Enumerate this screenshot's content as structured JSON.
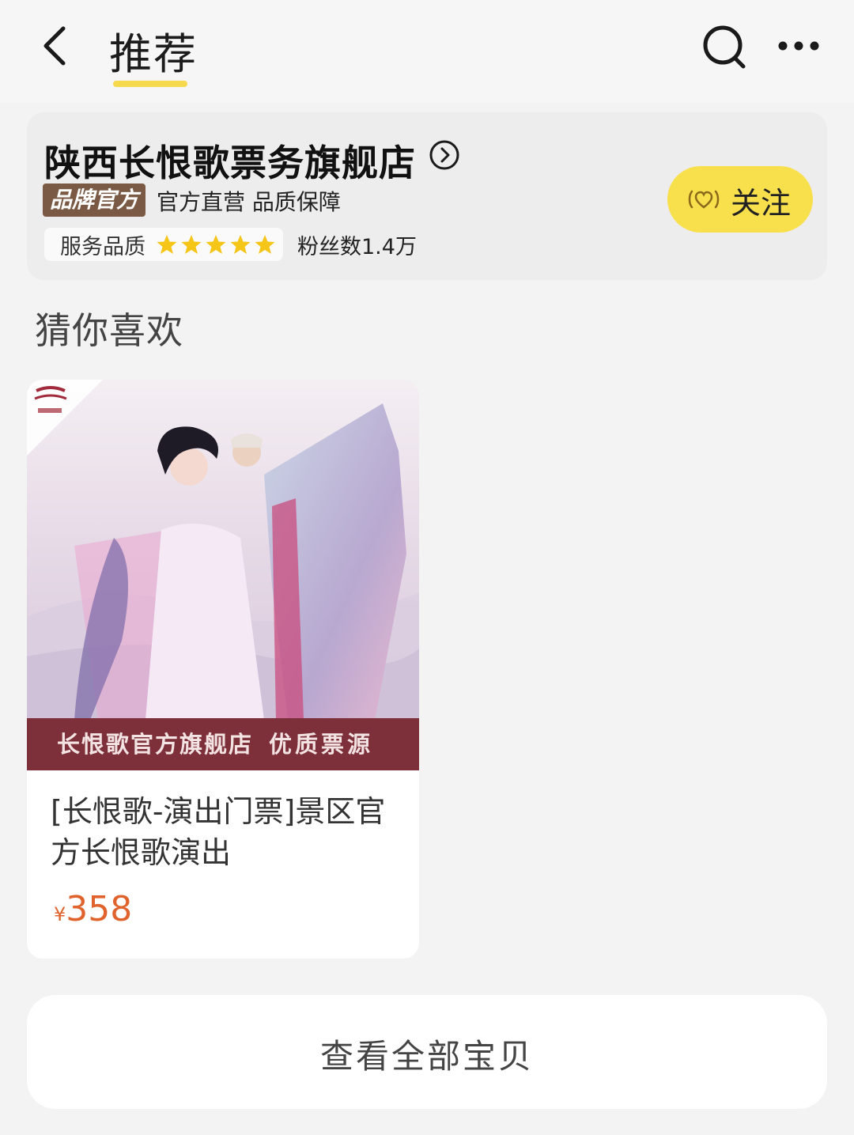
{
  "header": {
    "tab_title": "推荐",
    "back_icon": "chevron-left-icon",
    "search_icon": "search-icon",
    "more_icon": "more-horizontal-icon"
  },
  "store": {
    "name": "陕西长恨歌票务旗舰店",
    "badge": "品牌官方",
    "description": "官方直营 品质保障",
    "service_label": "服务品质",
    "service_rating": 5,
    "fans": "粉丝数1.4万",
    "follow_label": "关注",
    "accent_color": "#f8e04c"
  },
  "recommend": {
    "section_title": "猜你喜欢",
    "products": [
      {
        "banner_left": "长恨歌官方旗舰店",
        "banner_right": "优质票源",
        "title": "[长恨歌-演出门票]景区官方长恨歌演出",
        "currency": "¥",
        "price": "358"
      }
    ]
  },
  "footer": {
    "view_all_label": "查看全部宝贝"
  },
  "colors": {
    "price": "#e0622c",
    "banner": "#7d2f3a",
    "brand_badge": "#7a5a44"
  }
}
